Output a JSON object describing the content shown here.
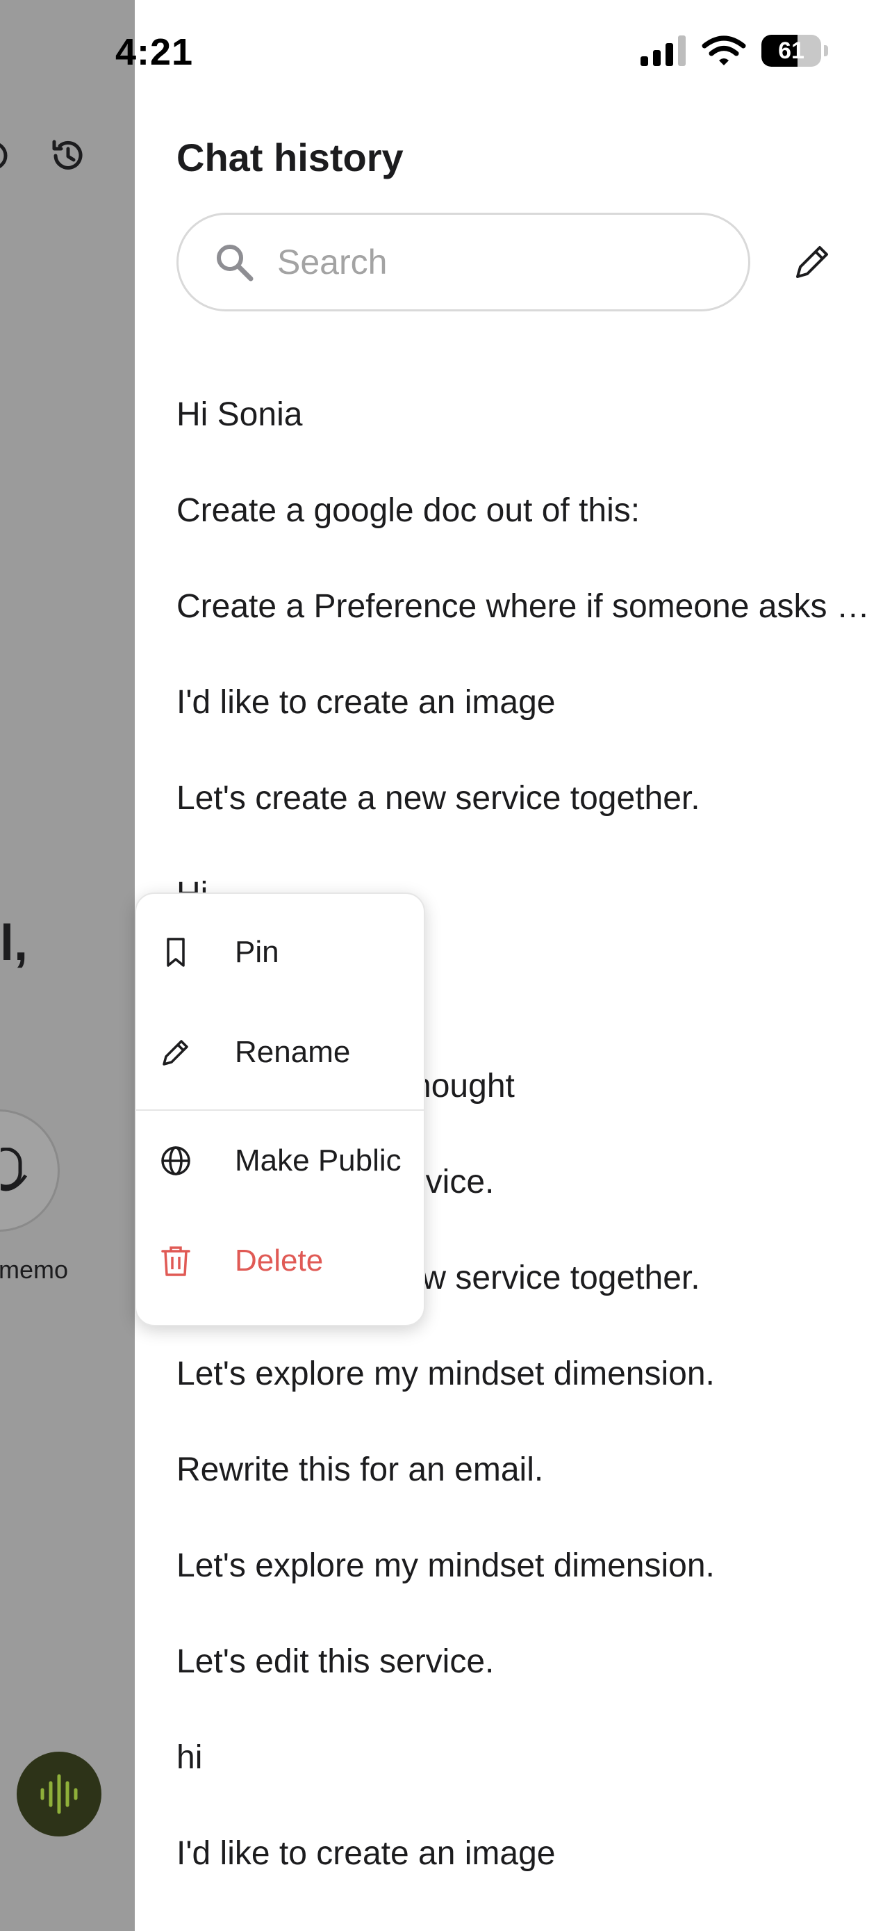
{
  "status_bar": {
    "time": "4:21",
    "battery_level": 61,
    "battery_text": "61"
  },
  "background_app": {
    "greeting_fragment": "el,",
    "mic_caption": "memo",
    "accent_color": "#2d3318",
    "wave_color": "#8fb03a"
  },
  "drawer": {
    "title": "Chat history",
    "search": {
      "placeholder": "Search",
      "value": ""
    },
    "chats": [
      "Hi Sonia",
      "Create a google doc out of this:",
      "Create a Preference where if someone asks about my schedule",
      "I'd like to create an image",
      "Let's create a new service together.",
      "Hi",
      "",
      "Let's capture a thought",
      "Let's edit this service.",
      "Let's create a new service together.",
      "Let's explore my mindset dimension.",
      "Rewrite this for an email.",
      "Let's explore my mindset dimension.",
      "Let's edit this service.",
      "hi",
      "I'd like to create an image"
    ]
  },
  "context_menu": {
    "items": [
      {
        "label": "Pin",
        "icon": "bookmark-icon"
      },
      {
        "label": "Rename",
        "icon": "pencil-icon"
      },
      {
        "label": "Make Public",
        "icon": "globe-icon"
      },
      {
        "label": "Delete",
        "icon": "trash-icon",
        "color": "#e05a55"
      }
    ]
  }
}
